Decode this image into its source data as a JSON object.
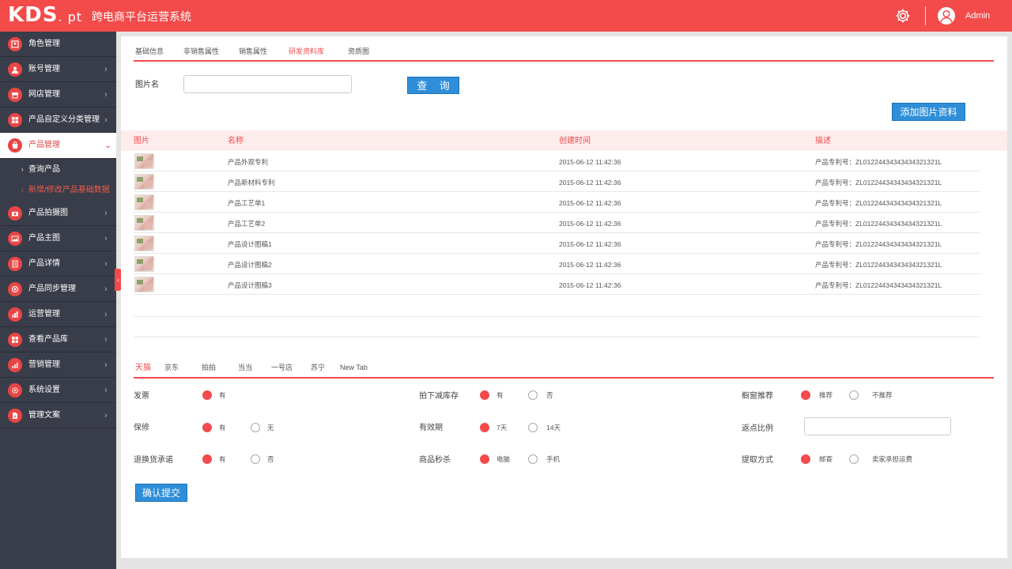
{
  "header": {
    "logo_main": "KDS",
    "logo_suffix": ". pt",
    "title": "跨电商平台运营系统",
    "user": "Admin",
    "settings_icon": "gear-icon",
    "avatar_icon": "user-icon"
  },
  "sidebar": {
    "items": [
      {
        "label": "角色管理"
      },
      {
        "label": "账号管理"
      },
      {
        "label": "网店管理"
      },
      {
        "label": "产品自定义分类管理"
      },
      {
        "label": "产品管理"
      },
      {
        "label": "产品拍摄图"
      },
      {
        "label": "产品主图"
      },
      {
        "label": "产品详情"
      },
      {
        "label": "产品同步管理"
      },
      {
        "label": "运营管理"
      },
      {
        "label": "查看产品库"
      },
      {
        "label": "营销管理"
      },
      {
        "label": "系统设置"
      },
      {
        "label": "管理文案"
      }
    ],
    "sub_items": [
      {
        "label": "查询产品"
      },
      {
        "label": "新增/修改产品基础数据"
      }
    ]
  },
  "top_tabs": [
    "基础信息",
    "非销售属性",
    "销售属性",
    "研发资料库",
    "资质图"
  ],
  "search": {
    "label": "图片名",
    "value": "",
    "button": "查 询"
  },
  "add_button": "添加图片资料",
  "table": {
    "headers": [
      "图片",
      "名称",
      "创建时间",
      "描述"
    ],
    "rows": [
      {
        "name": "产品外观专利",
        "created": "2015-06-12 11:42:36",
        "desc": "产品专利号：ZL01224434343434321321L"
      },
      {
        "name": "产品新材料专利",
        "created": "2015-06-12 11:42:36",
        "desc": "产品专利号：ZL01224434343434321321L"
      },
      {
        "name": "产品工艺单1",
        "created": "2015-06-12 11:42:36",
        "desc": "产品专利号：ZL01224434343434321321L"
      },
      {
        "name": "产品工艺单2",
        "created": "2015-06-12 11:42:36",
        "desc": "产品专利号：ZL01224434343434321321L"
      },
      {
        "name": "产品设计图稿1",
        "created": "2015-06-12 11:42:36",
        "desc": "产品专利号：ZL01224434343434321321L"
      },
      {
        "name": "产品设计图稿2",
        "created": "2015-06-12 11:42:36",
        "desc": "产品专利号：ZL01224434343434321321L"
      },
      {
        "name": "产品设计图稿3",
        "created": "2015-06-12 11:42:36",
        "desc": "产品专利号：ZL01224434343434321321L"
      }
    ]
  },
  "platform_tabs": [
    "天猫",
    "京东",
    "拍拍",
    "当当",
    "一号店",
    "苏宁",
    "New Tab"
  ],
  "form": {
    "invoice": {
      "label": "发票",
      "options": [
        "有"
      ],
      "selected": "有"
    },
    "warranty": {
      "label": "保修",
      "options": [
        "有",
        "无"
      ],
      "selected": "有"
    },
    "return_promise": {
      "label": "退换货承诺",
      "options": [
        "有",
        "否"
      ],
      "selected": "有"
    },
    "reduce_stock": {
      "label": "拍下减库存",
      "options": [
        "有",
        "否"
      ],
      "selected": "有"
    },
    "validity": {
      "label": "有效期",
      "options": [
        "7天",
        "14天"
      ],
      "selected": "7天"
    },
    "flash_sale": {
      "label": "商品秒杀",
      "options": [
        "电脑",
        "手机"
      ],
      "selected": "电脑"
    },
    "window_recommend": {
      "label": "橱窗推荐",
      "options": [
        "推荐",
        "不推荐"
      ],
      "selected": "推荐"
    },
    "rebate_ratio": {
      "label": "返点比例",
      "value": ""
    },
    "pickup": {
      "label": "提取方式",
      "options": [
        "邮寄",
        "卖家承担运费"
      ],
      "selected": "邮寄"
    },
    "submit": "确认提交"
  },
  "colors": {
    "accent": "#f34a4a",
    "sidebar_bg": "#393d49",
    "button_blue": "#2f8ed8",
    "table_header_bg": "#fdecec"
  }
}
